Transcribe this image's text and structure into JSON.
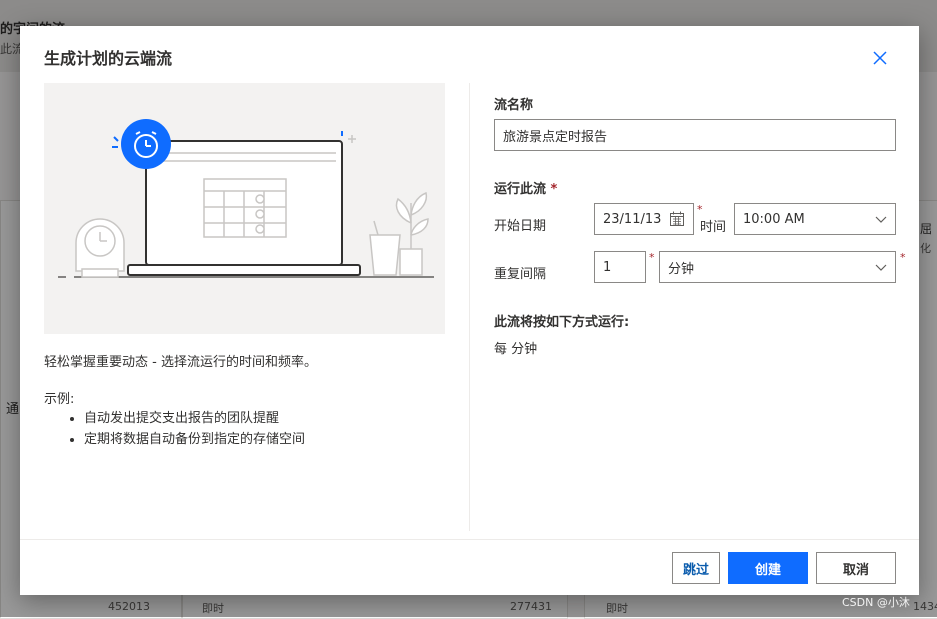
{
  "background": {
    "header_text": "的字间的流",
    "header_sub": "此流",
    "row_values": [
      "452013",
      "即时",
      "277431",
      "即时",
      "1434"
    ],
    "side_text_1": "通",
    "side_text_2": "屈",
    "side_text_3": "化"
  },
  "dialog": {
    "title": "生成计划的云端流",
    "description": "轻松掌握重要动态 - 选择流运行的时间和频率。",
    "examples_label": "示例:",
    "examples": [
      "自动发出提交支出报告的团队提醒",
      "定期将数据自动备份到指定的存储空间"
    ],
    "flow_name_label": "流名称",
    "flow_name_value": "旅游景点定时报告",
    "run_label": "运行此流",
    "required_mark": "*",
    "start_date_label": "开始日期",
    "start_date_value": "23/11/13",
    "time_label": "时间",
    "time_value": "10:00 AM",
    "repeat_label": "重复间隔",
    "repeat_value": "1",
    "repeat_unit": "分钟",
    "summary_label": "此流将按如下方式运行:",
    "summary_value": "每 分钟",
    "buttons": {
      "skip": "跳过",
      "create": "创建",
      "cancel": "取消"
    }
  },
  "watermark": "CSDN @小沐",
  "colors": {
    "accent": "#0f6cff",
    "required": "#a4262c",
    "link": "#0b5cad"
  },
  "icons": [
    "close-icon",
    "calendar-icon",
    "chevron-down-icon",
    "alarm-clock-icon"
  ]
}
